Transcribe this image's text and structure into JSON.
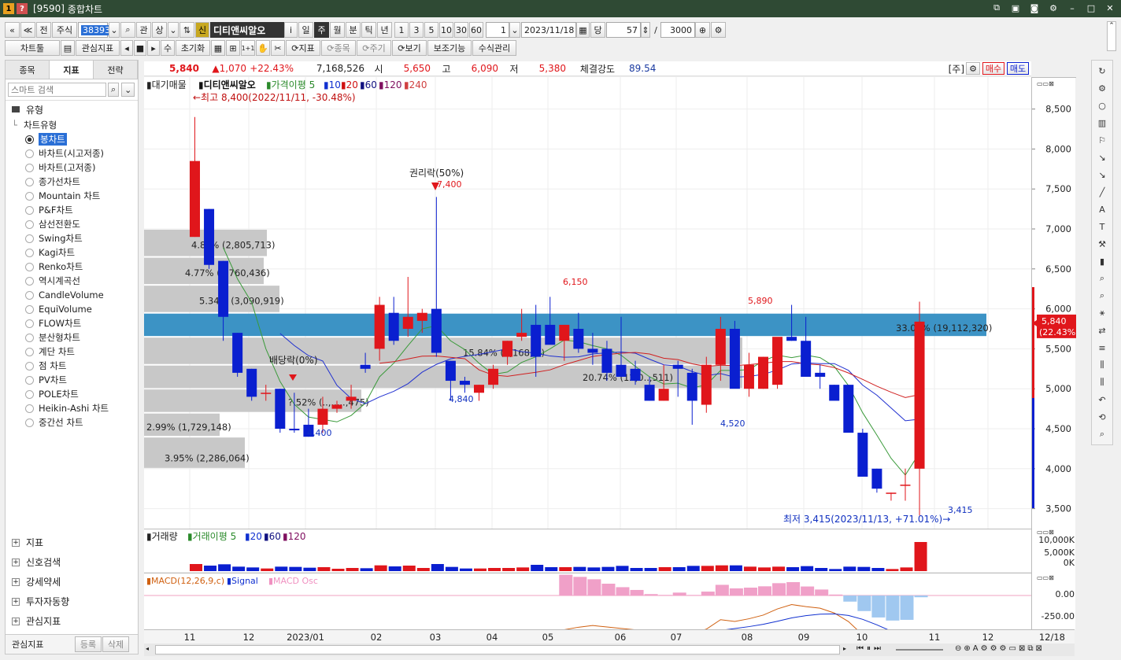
{
  "window": {
    "code": "[9590]",
    "title": "종합차트",
    "badge": "1"
  },
  "toolbar1": {
    "prev": "«",
    "up": "≪",
    "jeon": "전",
    "jusik": "주식",
    "code_value": "383930",
    "gwan": "관",
    "sang": "상",
    "sin": "신",
    "stock_name": "디티앤씨알오",
    "info": "i",
    "periods": [
      "일",
      "주",
      "월",
      "분",
      "틱",
      "년"
    ],
    "period_active": "주",
    "nums": [
      "1",
      "3",
      "5",
      "10",
      "30",
      "60"
    ],
    "unit_value": "1",
    "date_value": "2023/11/18",
    "dang": "당",
    "count_value": "57",
    "slash": "/",
    "total_value": "3000"
  },
  "toolbar2": {
    "charttool": "차트툴",
    "gwansim": "관심지표",
    "su": "수",
    "init": "초기화",
    "oneplus": "1+1",
    "jipyo": "지표",
    "jongmok": "종목",
    "jugi": "주기",
    "bogi": "보기",
    "bojogineung": "보조기능",
    "susikgwanri": "수식관리"
  },
  "left": {
    "tabs": [
      "종목",
      "지표",
      "전략"
    ],
    "search_placeholder": "스마트 검색",
    "group_title": "유형",
    "subgroup": "차트유형",
    "items": [
      "봉차트",
      "바차트(시고저종)",
      "바차트(고저종)",
      "종가선차트",
      "Mountain 차트",
      "P&F차트",
      "삼선전환도",
      "Swing차트",
      "Kagi차트",
      "Renko차트",
      "역시계곡선",
      "CandleVolume",
      "EquiVolume",
      "FLOW차트",
      "분산형차트",
      "계단 차트",
      "점 차트",
      "PV차트",
      "POLE차트",
      "Heikin-Ashi 차트",
      "중간선 차트"
    ],
    "groups": [
      "지표",
      "신호검색",
      "강세약세",
      "투자자동향",
      "관심지표"
    ],
    "bottom_label": "관심지표",
    "register": "등록",
    "delete": "삭제"
  },
  "pricebar": {
    "price": "5,840",
    "change": "▲1,070",
    "pct": "+22.43%",
    "volume": "7,168,526",
    "open_l": "시",
    "open": "5,650",
    "high_l": "고",
    "high": "6,090",
    "low_l": "저",
    "low": "5,380",
    "str_l": "체결강도",
    "str": "89.54",
    "ju": "[주]",
    "buy": "매수",
    "sell": "매도"
  },
  "legend": {
    "daegi": "대기매물",
    "name": "디티앤씨알오",
    "ma": "가격이평 5",
    "ma10": "10",
    "ma20": "20",
    "ma60": "60",
    "ma120": "120",
    "ma240": "240"
  },
  "annotations": {
    "max": "←최고 8,400(2022/11/11, -30.48%)",
    "min": "최저 3,415(2023/11/13, +71.01%)→",
    "rights": "권리락(50%)",
    "dividend": "배당락(0%)",
    "p7400": "7,400",
    "p6150": "6,150",
    "p5890": "5,890",
    "p4840": "4,840",
    "p4400": "4,400",
    "p4520": "4,520",
    "p3415": "3,415"
  },
  "profile": [
    "4.8?% (2,805,713)",
    "4.77% (2,760,436)",
    "5.34% (3,090,919)",
    "33.01% (19,112,320)",
    "15.84% (9,168,...)",
    "20.74% (12,0..,511)",
    "?.52% (..,.....,475)",
    "2.99% (1,729,148)",
    "3.95% (2,286,064)"
  ],
  "vol_legend": {
    "title": "거래량",
    "ma": "거래이평 5",
    "a": "20",
    "b": "60",
    "c": "120"
  },
  "macd_legend": {
    "macd": "MACD(12,26,9,c)",
    "signal": "Signal",
    "osc": "MACD Osc"
  },
  "yaxis": {
    "price": [
      "8,500",
      "8,000",
      "7,500",
      "7,000",
      "6,500",
      "6,000",
      "5,500",
      "5,000",
      "4,500",
      "4,000",
      "3,500"
    ],
    "current": "5,840",
    "current_pct": "(22.43%)",
    "vol": [
      "10,000K",
      "5,000K",
      "0K"
    ],
    "macd": [
      "0.00",
      "-250.00"
    ],
    "date_label": "12/18"
  },
  "xaxis": [
    "11",
    "12",
    "2023/01",
    "02",
    "03",
    "04",
    "05",
    "06",
    "07",
    "08",
    "09",
    "10",
    "11",
    "12"
  ],
  "colors": {
    "up": "#e0161b",
    "down": "#0a1fd0",
    "band": "#3c93c5"
  },
  "chart_data": {
    "type": "candlestick",
    "title": "",
    "xlabel": "",
    "ylabel": "",
    "ylim": [
      3250,
      8900
    ],
    "candles": [
      [
        6900,
        8400,
        6900,
        7850
      ],
      [
        7250,
        7250,
        6500,
        6550
      ],
      [
        6600,
        6600,
        5600,
        5900
      ],
      [
        5700,
        5700,
        5150,
        5200
      ],
      [
        5250,
        5250,
        4850,
        4900
      ],
      [
        4950,
        5050,
        4850,
        4950
      ],
      [
        5000,
        5000,
        4450,
        4500
      ],
      [
        4500,
        4950,
        4450,
        4480
      ],
      [
        4550,
        4750,
        4400,
        4400
      ],
      [
        4550,
        4900,
        4450,
        4750
      ],
      [
        4750,
        4850,
        4700,
        4800
      ],
      [
        4850,
        5050,
        4750,
        4900
      ],
      [
        5300,
        5450,
        5200,
        5250
      ],
      [
        5500,
        6150,
        5350,
        6050
      ],
      [
        5950,
        6150,
        5550,
        5600
      ],
      [
        5750,
        6400,
        5650,
        5900
      ],
      [
        5850,
        6000,
        5700,
        5950
      ],
      [
        6000,
        7400,
        5400,
        5450
      ],
      [
        5350,
        5350,
        4850,
        5100
      ],
      [
        5100,
        5150,
        4950,
        5050
      ],
      [
        4950,
        5050,
        4850,
        5050
      ],
      [
        5050,
        5300,
        5000,
        5250
      ],
      [
        5400,
        5600,
        5300,
        5600
      ],
      [
        5650,
        6000,
        5600,
        5700
      ],
      [
        5800,
        6050,
        5150,
        5400
      ],
      [
        5800,
        6150,
        5700,
        5550
      ],
      [
        5600,
        5800,
        5350,
        5800
      ],
      [
        5750,
        5950,
        5450,
        5500
      ],
      [
        5500,
        5700,
        5300,
        5450
      ],
      [
        5500,
        5600,
        5100,
        5200
      ],
      [
        5300,
        5900,
        5200,
        5150
      ],
      [
        5250,
        5350,
        5050,
        5100
      ],
      [
        5050,
        5150,
        4850,
        4850
      ],
      [
        4850,
        5300,
        4850,
        5000
      ],
      [
        5300,
        5350,
        4900,
        5250
      ],
      [
        5200,
        5250,
        4550,
        4850
      ],
      [
        4800,
        5400,
        4700,
        5300
      ],
      [
        5300,
        5900,
        5100,
        5750
      ],
      [
        5750,
        5850,
        5050,
        5000
      ],
      [
        5000,
        5450,
        4900,
        5300
      ],
      [
        5000,
        5400,
        5000,
        5400
      ],
      [
        5050,
        5550,
        5000,
        5650
      ],
      [
        5650,
        6050,
        5600,
        5600
      ],
      [
        5600,
        5900,
        5250,
        5150
      ],
      [
        5200,
        5300,
        5000,
        5150
      ],
      [
        5050,
        5050,
        4950,
        4850
      ],
      [
        5050,
        5050,
        4500,
        4450
      ],
      [
        4450,
        4500,
        4000,
        3900
      ],
      [
        4000,
        4000,
        3700,
        3750
      ],
      [
        3700,
        3700,
        3600,
        3700
      ],
      [
        3800,
        4000,
        3600,
        3800
      ],
      [
        4000,
        6090,
        3415,
        5840
      ]
    ]
  }
}
